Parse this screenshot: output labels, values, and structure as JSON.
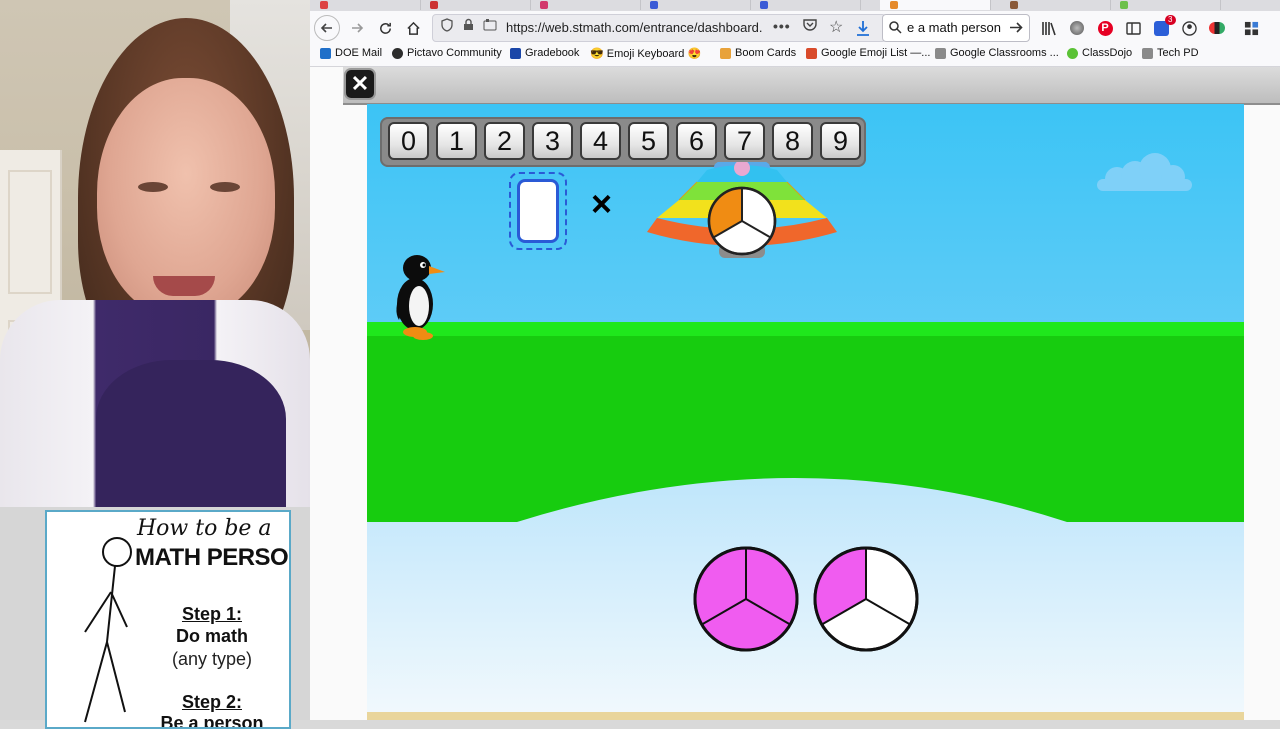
{
  "browser": {
    "url": "https://web.stmath.com/entrance/dashboard.",
    "search_query": "e a math person",
    "download_badge": "3",
    "bookmarks": [
      {
        "label": "DOE Mail",
        "color": "#1f6fc9"
      },
      {
        "label": "Pictavo Community",
        "color": "#2d2d2d"
      },
      {
        "label": "Gradebook",
        "color": "#1a46a8"
      },
      {
        "label": "😎 Emoji Keyboard 😍",
        "color": "#f7c948"
      },
      {
        "label": "Boom Cards",
        "color": "#e8a23a"
      },
      {
        "label": "Google Emoji List —...",
        "color": "#d94b2b"
      },
      {
        "label": "Google Classrooms ...",
        "color": "#8a8a8a"
      },
      {
        "label": "ClassDojo",
        "color": "#5bc236"
      },
      {
        "label": "Tech PD",
        "color": "#8a8a8a"
      }
    ]
  },
  "game": {
    "close_label": "✕",
    "number_keys": [
      "0",
      "1",
      "2",
      "3",
      "4",
      "5",
      "6",
      "7",
      "8",
      "9"
    ],
    "operator": "×",
    "answer_value": "",
    "ufo_fraction": {
      "filled": 1,
      "total": 3,
      "fill_color": "#f08c13"
    },
    "target_pies": [
      {
        "filled": 3,
        "total": 3,
        "fill_color": "#f05cf0"
      },
      {
        "filled": 1,
        "total": 3,
        "fill_color": "#f05cf0"
      }
    ]
  },
  "poster": {
    "title_script": "How to be a",
    "title": "MATH PERSON:",
    "step1_heading": "Step 1:",
    "step1_text": "Do math",
    "step1_sub": "(any type)",
    "step2_heading": "Step 2:",
    "step2_text": "Be a person"
  }
}
